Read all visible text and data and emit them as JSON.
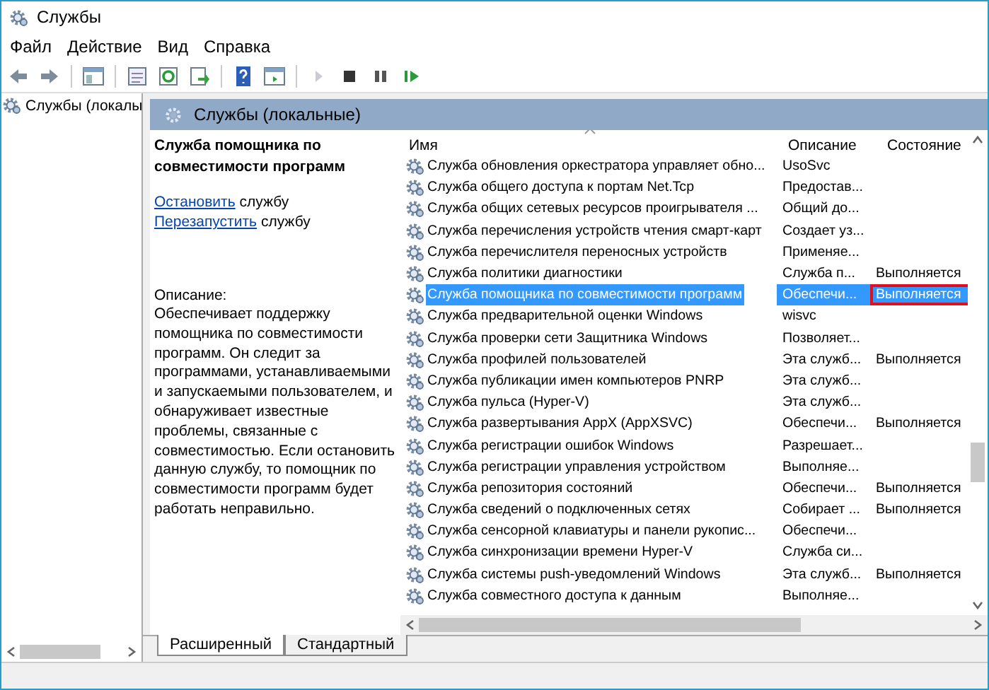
{
  "window": {
    "title": "Службы"
  },
  "menu": [
    "Файл",
    "Действие",
    "Вид",
    "Справка"
  ],
  "toolbar": [
    {
      "kind": "back",
      "disabled": false
    },
    {
      "kind": "forward",
      "disabled": false
    },
    {
      "kind": "sep"
    },
    {
      "kind": "console",
      "disabled": false
    },
    {
      "kind": "sep"
    },
    {
      "kind": "properties",
      "disabled": false
    },
    {
      "kind": "refresh",
      "disabled": false
    },
    {
      "kind": "export",
      "disabled": false
    },
    {
      "kind": "sep"
    },
    {
      "kind": "help",
      "disabled": false
    },
    {
      "kind": "panel",
      "disabled": false
    },
    {
      "kind": "sep"
    },
    {
      "kind": "play",
      "disabled": true
    },
    {
      "kind": "stop",
      "disabled": false
    },
    {
      "kind": "pause",
      "disabled": false
    },
    {
      "kind": "resume",
      "disabled": false
    }
  ],
  "tree": {
    "items": [
      {
        "label": "Службы (локалы",
        "selected": false
      }
    ]
  },
  "header": {
    "title": "Службы (локальные)"
  },
  "details": {
    "title": "Служба помощника по совместимости программ",
    "actions": [
      {
        "link": "Остановить",
        "text": "службу"
      },
      {
        "link": "Перезапустить",
        "text": "службу"
      }
    ],
    "description_label": "Описание:",
    "description": "Обеспечивает поддержку помощника по совместимости программ. Он следит за программами, устанавливаемыми и запускаемыми пользователем, и обнаруживает известные проблемы, связанные с совместимостью. Если остановить данную службу, то помощник по совместимости программ будет работать неправильно."
  },
  "table": {
    "columns": [
      "Имя",
      "Описание",
      "Состояние"
    ],
    "rows": [
      {
        "name": "Служба обновления оркестратора управляет обно...",
        "description": "UsoSvc",
        "state": "",
        "selected": false,
        "marked": false
      },
      {
        "name": "Служба общего доступа к портам Net.Tcp",
        "description": "Предостав...",
        "state": "",
        "selected": false,
        "marked": false
      },
      {
        "name": "Служба общих сетевых ресурсов проигрывателя ...",
        "description": "Общий до...",
        "state": "",
        "selected": false,
        "marked": false
      },
      {
        "name": "Служба перечисления устройств чтения смарт-карт",
        "description": "Создает уз...",
        "state": "",
        "selected": false,
        "marked": false
      },
      {
        "name": "Служба перечислителя переносных устройств",
        "description": "Применяе...",
        "state": "",
        "selected": false,
        "marked": false
      },
      {
        "name": "Служба политики диагностики",
        "description": "Служба п...",
        "state": "Выполняется",
        "selected": false,
        "marked": false
      },
      {
        "name": "Служба помощника по совместимости программ",
        "description": "Обеспечи...",
        "state": "Выполняется",
        "selected": true,
        "marked": true
      },
      {
        "name": "Служба предварительной оценки Windows",
        "description": "wisvc",
        "state": "",
        "selected": false,
        "marked": false
      },
      {
        "name": "Служба проверки сети Защитника Windows",
        "description": "Позволяет...",
        "state": "",
        "selected": false,
        "marked": false
      },
      {
        "name": "Служба профилей пользователей",
        "description": "Эта служб...",
        "state": "Выполняется",
        "selected": false,
        "marked": false
      },
      {
        "name": "Служба публикации имен компьютеров PNRP",
        "description": "Эта служб...",
        "state": "",
        "selected": false,
        "marked": false
      },
      {
        "name": "Служба пульса (Hyper-V)",
        "description": "Эта служб...",
        "state": "",
        "selected": false,
        "marked": false
      },
      {
        "name": "Служба развертывания AppX (AppXSVC)",
        "description": "Обеспечи...",
        "state": "Выполняется",
        "selected": false,
        "marked": false
      },
      {
        "name": "Служба регистрации ошибок Windows",
        "description": "Разрешает...",
        "state": "",
        "selected": false,
        "marked": false
      },
      {
        "name": "Служба регистрации управления устройством",
        "description": "Выполняе...",
        "state": "",
        "selected": false,
        "marked": false
      },
      {
        "name": "Служба репозитория состояний",
        "description": "Обеспечи...",
        "state": "Выполняется",
        "selected": false,
        "marked": false
      },
      {
        "name": "Служба сведений о подключенных сетях",
        "description": "Собирает ...",
        "state": "Выполняется",
        "selected": false,
        "marked": false
      },
      {
        "name": "Служба сенсорной клавиатуры и панели рукопис...",
        "description": "Обеспечи...",
        "state": "",
        "selected": false,
        "marked": false
      },
      {
        "name": "Служба синхронизации времени Hyper-V",
        "description": "Служба си...",
        "state": "",
        "selected": false,
        "marked": false
      },
      {
        "name": "Служба системы push-уведомлений Windows",
        "description": "Эта служб...",
        "state": "Выполняется",
        "selected": false,
        "marked": false
      },
      {
        "name": "Служба совместного доступа к данным",
        "description": "Выполняе...",
        "state": "",
        "selected": false,
        "marked": false
      }
    ]
  },
  "tabs": [
    {
      "label": "Расширенный",
      "selected": true
    },
    {
      "label": "Стандартный",
      "selected": false
    }
  ]
}
